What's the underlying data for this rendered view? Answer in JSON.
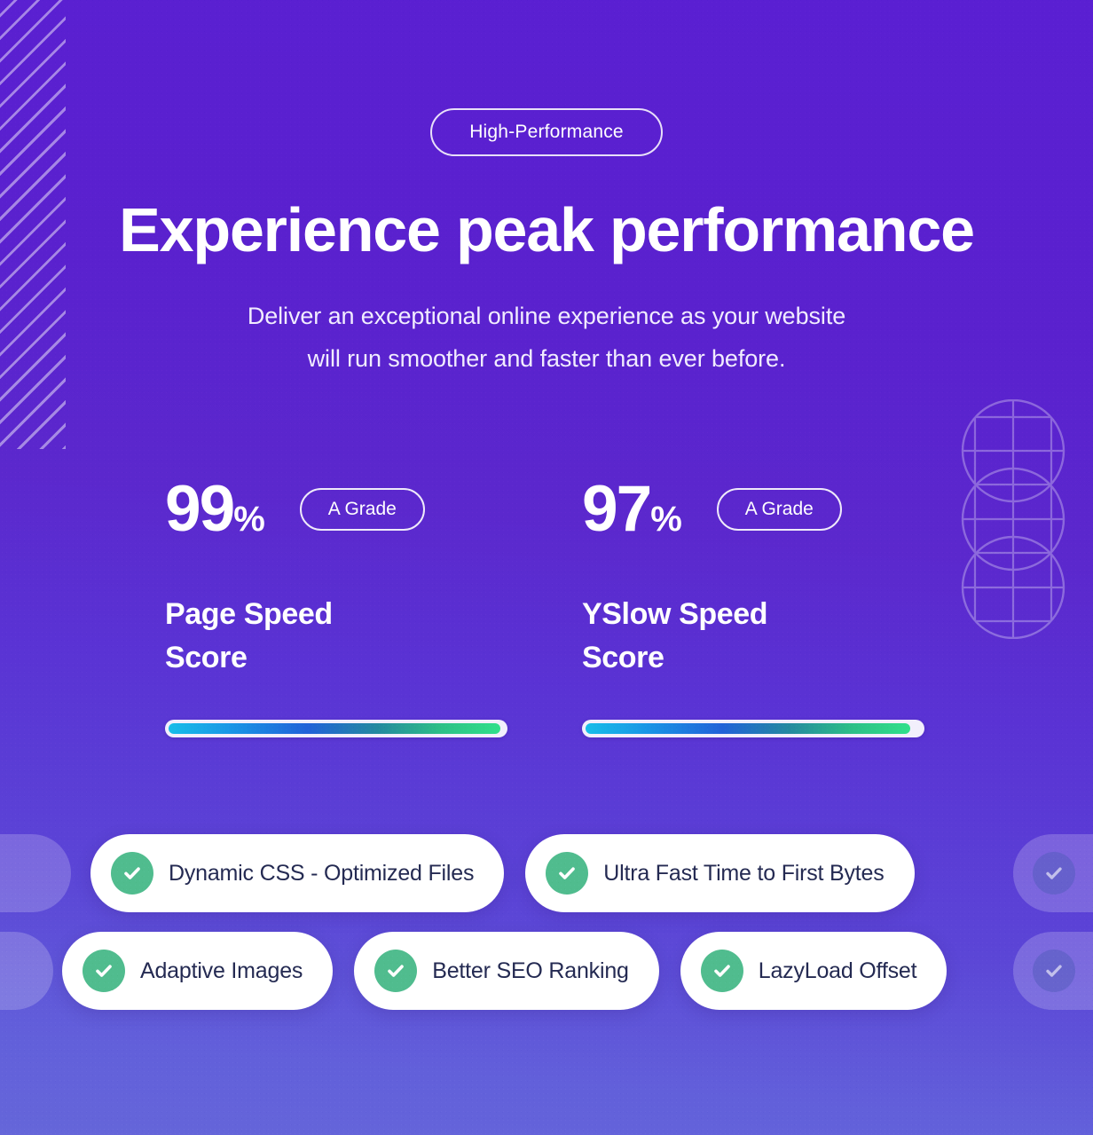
{
  "theme": {
    "bg_top": "#5A21CE",
    "bg_bottom": "#6566D9",
    "text_on_dark": "#FFFFFF",
    "pill_bg": "#FFFFFF",
    "pill_text": "#242A52",
    "check_green": "#50BC8E",
    "progress_gradient_stops": [
      "#17BDE8",
      "#1897E6",
      "#2161D8",
      "#2DBF87",
      "#2FE08A"
    ]
  },
  "hero": {
    "eyebrow_badge": "High-Performance",
    "headline": "Experience peak performance",
    "subhead_line1": "Deliver an exceptional online experience as your website",
    "subhead_line2": "will run smoother and faster than ever before."
  },
  "scores": [
    {
      "value": "99",
      "unit": "%",
      "grade": "A Grade",
      "label_line1": "Page Speed",
      "label_line2": "Score",
      "progress_percent": 99
    },
    {
      "value": "97",
      "unit": "%",
      "grade": "A Grade",
      "label_line1": "YSlow Speed",
      "label_line2": "Score",
      "progress_percent": 97
    }
  ],
  "features": {
    "row1": [
      {
        "label": "Dynamic CSS - Optimized Files",
        "icon": "check-circle-icon"
      },
      {
        "label": "Ultra Fast Time to First Bytes",
        "icon": "check-circle-icon"
      }
    ],
    "row2": [
      {
        "label": "Adaptive Images",
        "icon": "check-circle-icon"
      },
      {
        "label": "Better SEO Ranking",
        "icon": "check-circle-icon"
      },
      {
        "label": "LazyLoad Offset",
        "icon": "check-circle-icon"
      }
    ]
  },
  "decorations": {
    "diagonal_stripes": "diagonal-stripes-pattern",
    "circle_grid": "overlapping-circles-grid-pattern"
  }
}
